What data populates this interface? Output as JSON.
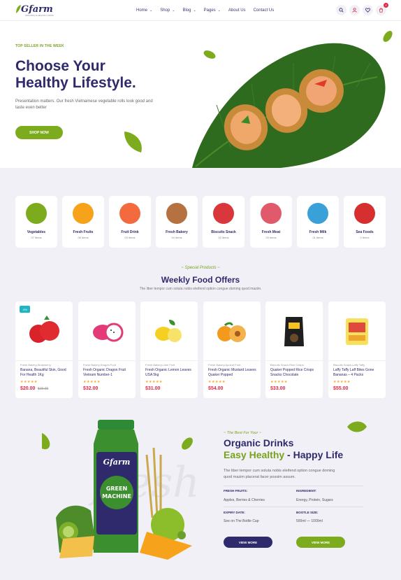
{
  "header": {
    "logo_text": "Gfarm",
    "logo_sub": "ORGANIC & HEALTHY FOOD",
    "nav": [
      {
        "label": "Home",
        "dropdown": true
      },
      {
        "label": "Shop",
        "dropdown": true
      },
      {
        "label": "Blog",
        "dropdown": true
      },
      {
        "label": "Pages",
        "dropdown": true
      },
      {
        "label": "About Us",
        "dropdown": false
      },
      {
        "label": "Contact Us",
        "dropdown": false
      }
    ],
    "icons": [
      "search-icon",
      "user-icon",
      "heart-icon",
      "cart-icon"
    ],
    "cart_count": "0"
  },
  "hero": {
    "kicker": "TOP SELLER IN THE WEEK",
    "title_line1": "Choose Your",
    "title_line2": "Healthy Lifestyle.",
    "description": "Presentation matters. Our fresh Vietnamese vegetable rolls look good and taste even better",
    "button": "SHOP NOW"
  },
  "categories": [
    {
      "name": "Vegetables",
      "count": "07 items",
      "color": "#7cac1d"
    },
    {
      "name": "Fresh Fruits",
      "count": "06 items",
      "color": "#f7a21b"
    },
    {
      "name": "Fruit Drink",
      "count": "03 items",
      "color": "#f26a3d"
    },
    {
      "name": "Fresh Bakery",
      "count": "04 items",
      "color": "#b5713f"
    },
    {
      "name": "Biscuits Snack",
      "count": "02 items",
      "color": "#d9373b"
    },
    {
      "name": "Fresh Meat",
      "count": "03 items",
      "color": "#e05a6b"
    },
    {
      "name": "Fresh Milk",
      "count": "01 items",
      "color": "#3aa0d8"
    },
    {
      "name": "Sea Foods",
      "count": "0 items",
      "color": "#d62f2f"
    }
  ],
  "offers": {
    "kicker": "~ Special Products ~",
    "title": "Weekly Food Offers",
    "description": "The liber tempor cum soluta nobis eleifend option congue doming quod mazim."
  },
  "products": [
    {
      "category": "Fresh Bakery,Strawberry",
      "name": "Banana, Beautiful Skin, Good For Health 1Kg",
      "stars": "★★★★★",
      "price": "$20.00",
      "old_price": "$19.00",
      "badge": "-5%",
      "icon": "strawberry-icon"
    },
    {
      "category": "Fresh Bakery,Dragon Fruit",
      "name": "Fresh Organic Dragon Fruit Vietnam Number-1",
      "stars": "★★★★★",
      "price": "$32.00",
      "icon": "dragon-fruit-icon"
    },
    {
      "category": "Fresh Bakery,Lime Fruit",
      "name": "Fresh Organic Lemon Leaves USA 5kg",
      "stars": "★★★★★",
      "price": "$31.00",
      "icon": "lemon-icon"
    },
    {
      "category": "Fresh Bakery,Apricot Fruit",
      "name": "Fresh Organic Mustard Leaves Quaker Popped",
      "stars": "★★★★★",
      "price": "$54.00",
      "icon": "apricot-icon"
    },
    {
      "category": "Biscuits Snack,Rice Crisps",
      "name": "Quaker Popped Rice Crisps Snacks Chocolate",
      "stars": "★★★★★",
      "price": "$33.00",
      "icon": "chips-bag-icon"
    },
    {
      "category": "Biscuits Snack,Laffy Taffy",
      "name": "Laffy Taffy Laff Bites Gone Bananas – 4 Packs",
      "stars": "★★★★★",
      "price": "$55.00",
      "icon": "candy-box-icon"
    }
  ],
  "drinks": {
    "kicker": "~ The Best For Your ~",
    "title_line1": "Organic Drinks",
    "title_green": "Easy Healthy",
    "title_rest": " - Happy Life",
    "description": "The liber tempor cum soluta nobis eleifend option congue doming quod mazim placerat facer possim assum.",
    "specs": [
      {
        "label": "FRESH FRUITS:",
        "value": "Apples, Berries & Cherries"
      },
      {
        "label": "INGREDIENT:",
        "value": "Energy, Protein, Sugars"
      },
      {
        "label": "EXPIRY DATE:",
        "value": "See on The Bottle Cap"
      },
      {
        "label": "BOOTLE SIZE:",
        "value": "500ml — 1000ml"
      }
    ],
    "bottle_brand": "Gfarm",
    "bottle_label": "GREEN MACHINE",
    "btn_more1": "VIEW MORE",
    "btn_more2": "VIEW MORE"
  }
}
